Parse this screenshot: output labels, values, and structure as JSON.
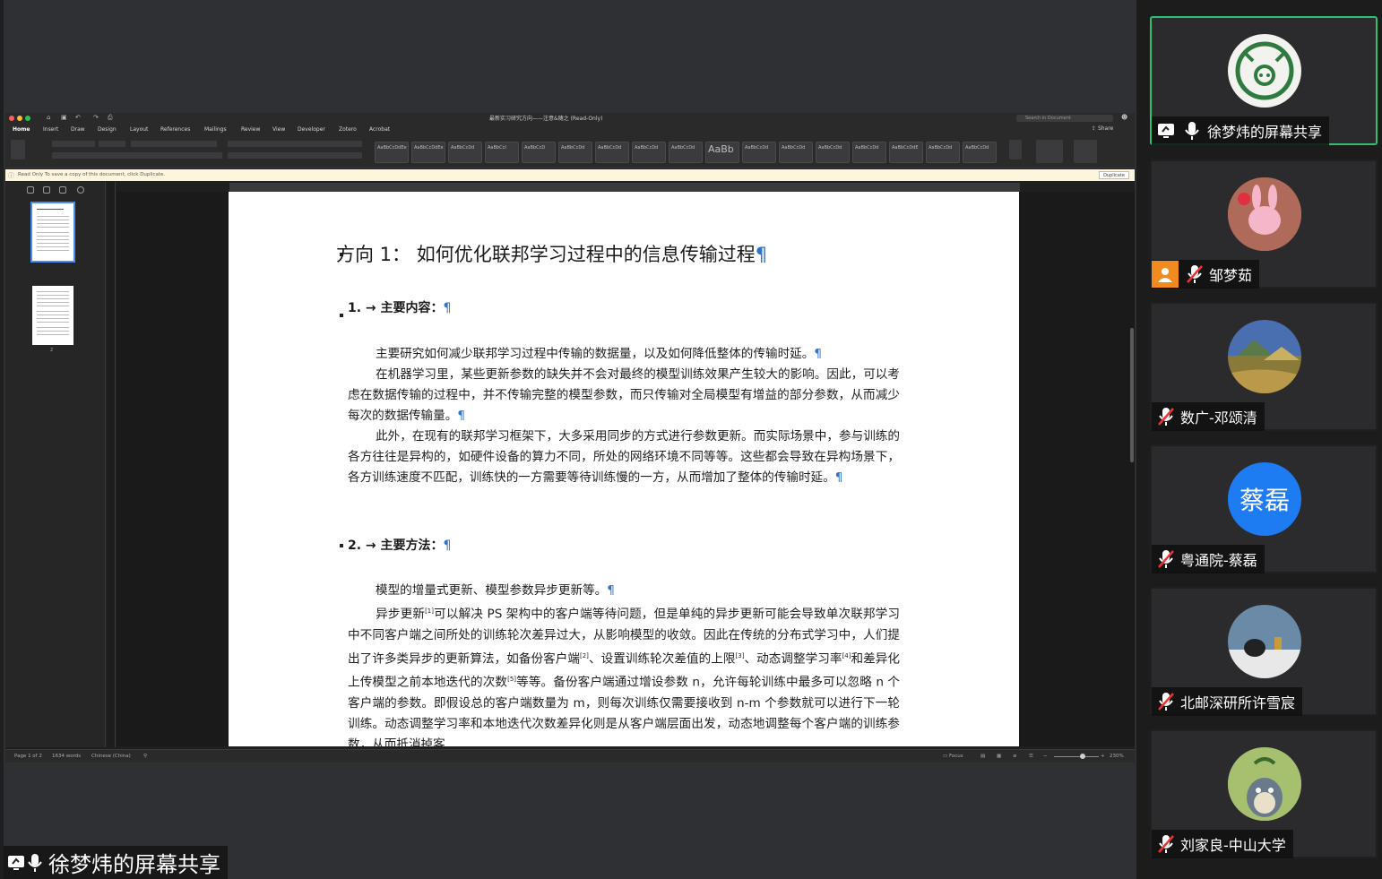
{
  "meeting": {
    "presenter_label": "徐梦炜的屏幕共享"
  },
  "word": {
    "doc_title": "最新实习研究方向——注意&随之 (Read-Only)",
    "search_placeholder": "Search in Document",
    "share_label": "Share",
    "tabs": [
      "Home",
      "Insert",
      "Draw",
      "Design",
      "Layout",
      "References",
      "Mailings",
      "Review",
      "View",
      "Developer",
      "Zotero",
      "Acrobat"
    ],
    "styles": [
      "AaBbCcDdEe",
      "AaBbCcDdEe",
      "AaBbCcDd",
      "AaBbCcI",
      "AaBbCcD",
      "AaBbCcDd",
      "AaBbCcDd",
      "AaBbCcDd",
      "AaBbCcDd",
      "AaBb",
      "AaBbCcDd",
      "AaBbCcDd",
      "AaBbCcDd",
      "AaBbCcDd",
      "AaBbCcDdE",
      "AaBbCcDd",
      "AaBbCcDd"
    ],
    "readonly_notice": "Read Only  To save a copy of this document, click Duplicate.",
    "duplicate_label": "Duplicate",
    "thumb_page2": "2",
    "status": {
      "page": "Page 1 of 2",
      "words": "1634 words",
      "language": "Chinese (China)",
      "focus": "Focus",
      "zoom": "230%"
    },
    "document": {
      "heading": "方向 1： 如何优化联邦学习过程中的信息传输过程",
      "section1": "1. → 主要内容：",
      "s1_p1": "主要研究如何减少联邦学习过程中传输的数据量，以及如何降低整体的传输时延。",
      "s1_p2": "在机器学习里，某些更新参数的缺失并不会对最终的模型训练效果产生较大的影响。因此，可以考虑在数据传输的过程中，并不传输完整的模型参数，而只传输对全局模型有增益的部分参数，从而减少每次的数据传输量。",
      "s1_p3": "此外，在现有的联邦学习框架下，大多采用同步的方式进行参数更新。而实际场景中，参与训练的各方往往是异构的，如硬件设备的算力不同，所处的网络环境不同等等。这些都会导致在异构场景下，各方训练速度不匹配，训练快的一方需要等待训练慢的一方，从而增加了整体的传输时延。",
      "section2": "2. → 主要方法：",
      "s2_p1": "模型的增量式更新、模型参数异步更新等。",
      "s2_p2a": "异步更新",
      "s2_p2b": "可以解决 PS 架构中的客户端等待问题，但是单纯的异步更新可能会导致单次联邦学习中不同客户端之间所处的训练轮次差异过大，从影响模型的收敛。因此在传统的分布式学习中，人们提出了许多类异步的更新算法，如备份客户端",
      "s2_p2c": "、设置训练轮次差值的上限",
      "s2_p2d": "、动态调整学习率",
      "s2_p2e": "和差异化上传模型之前本地迭代的次数",
      "s2_p2f": "等等。备份客户端通过增设参数 n，允许每轮训练中最多可以忽略 n 个客户端的参数。即假设总的客户端数量为 m，则每次训练仅需要接收到 n-m 个参数就可以进行下一轮训练。动态调整学习率和本地迭代次数差异化则是从客户端层面出发，动态地调整每个客户端的训练参数，从而抵消掉客",
      "refs": [
        "[1]",
        "[2]",
        "[3]",
        "[4]",
        "[5]"
      ]
    }
  },
  "participants": [
    {
      "name": "徐梦炜的屏幕共享",
      "muted": false,
      "active": true,
      "avatar": "pig-logo"
    },
    {
      "name": "邹梦茹",
      "muted": true,
      "active": false,
      "avatar": "cartoon-bunny"
    },
    {
      "name": "数广-邓颂清",
      "muted": true,
      "active": false,
      "avatar": "painting-landscape"
    },
    {
      "name": "粤通院-蔡磊",
      "muted": true,
      "active": false,
      "avatar": "text-avatar",
      "initials": "蔡磊",
      "color": "#1e7cf2"
    },
    {
      "name": "北邮深研所许雪宸",
      "muted": true,
      "active": false,
      "avatar": "teapot-scene"
    },
    {
      "name": "刘家良-中山大学",
      "muted": true,
      "active": false,
      "avatar": "totoro"
    }
  ],
  "colors": {
    "active_border": "#2fbf71",
    "muted_icon": "#ffffff",
    "pilcrow": "#2f74c9",
    "user_badge": "#f18a1f"
  }
}
